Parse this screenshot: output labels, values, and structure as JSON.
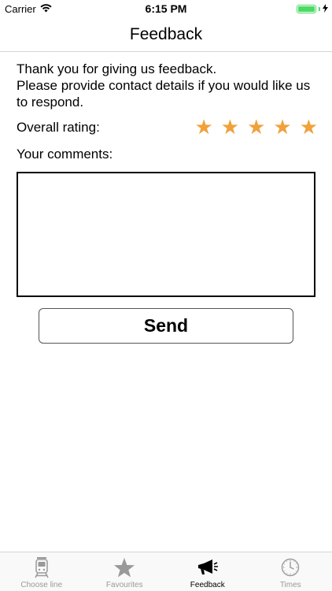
{
  "status_bar": {
    "carrier": "Carrier",
    "time": "6:15 PM"
  },
  "nav": {
    "title": "Feedback"
  },
  "intro": {
    "line1": "Thank you for giving us feedback.",
    "line2": "Please provide contact details if you would like us to respond."
  },
  "rating": {
    "label": "Overall rating:",
    "value": 5,
    "max": 5,
    "star_glyph": "★",
    "star_color": "#f0a13a"
  },
  "comments": {
    "label": "Your comments:",
    "value": ""
  },
  "send_button": {
    "label": "Send"
  },
  "tab_bar": {
    "tabs": [
      {
        "label": "Choose line",
        "icon": "train-icon",
        "active": false
      },
      {
        "label": "Favourites",
        "icon": "star-icon",
        "active": false
      },
      {
        "label": "Feedback",
        "icon": "megaphone-icon",
        "active": true
      },
      {
        "label": "Times",
        "icon": "clock-icon",
        "active": false
      }
    ]
  },
  "colors": {
    "battery": "#4cd964",
    "star": "#f0a13a",
    "tab_inactive": "#999999",
    "tab_active": "#000000"
  }
}
